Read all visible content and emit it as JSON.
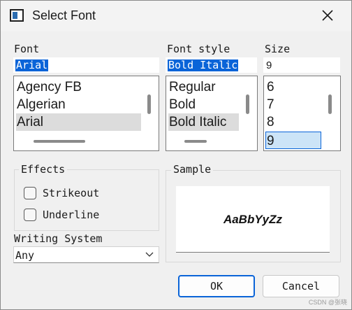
{
  "window": {
    "title": "Select Font",
    "close_icon": "close-icon"
  },
  "font": {
    "label": "Font",
    "value": "Arial",
    "items": [
      "Agency FB",
      "Algerian",
      "Arial"
    ],
    "selected": "Arial"
  },
  "style": {
    "label": "Font style",
    "value": "Bold Italic",
    "items": [
      "Regular",
      "Bold",
      "Bold Italic"
    ],
    "selected": "Bold Italic"
  },
  "size": {
    "label": "Size",
    "value": "9",
    "items": [
      "6",
      "7",
      "8",
      "9"
    ],
    "selected": "9"
  },
  "effects": {
    "title": "Effects",
    "strikeout": {
      "label": "Strikeout",
      "checked": false
    },
    "underline": {
      "label": "Underline",
      "checked": false
    }
  },
  "sample": {
    "title": "Sample",
    "text": "AaBbYyZz"
  },
  "writing_system": {
    "label": "Writing System",
    "value": "Any"
  },
  "buttons": {
    "ok": "OK",
    "cancel": "Cancel"
  },
  "watermark": "CSDN @张晓"
}
